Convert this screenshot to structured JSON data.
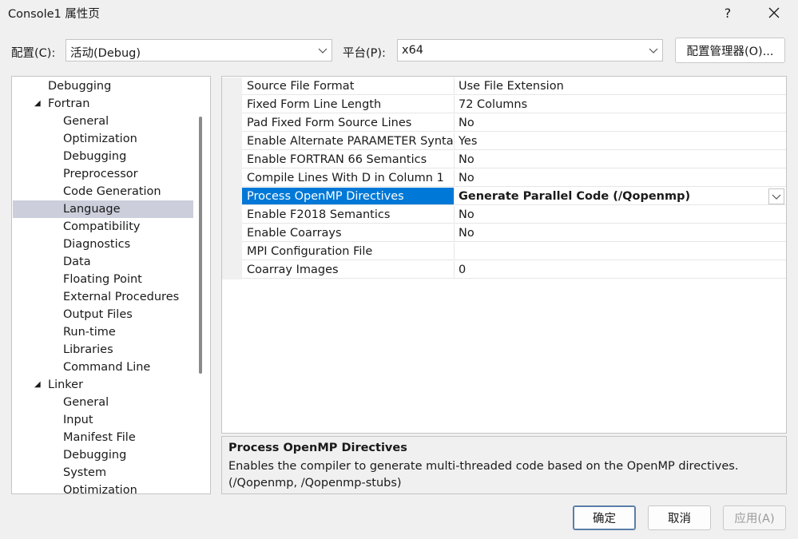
{
  "window": {
    "title": "Console1 属性页",
    "help_label": "?",
    "close_label": "✕"
  },
  "config_bar": {
    "config_label": "配置(C):",
    "config_value": "活动(Debug)",
    "platform_label": "平台(P):",
    "platform_value": "x64",
    "manager_button": "配置管理器(O)..."
  },
  "tree": {
    "items": [
      {
        "label": "Debugging",
        "level": 0,
        "expander": ""
      },
      {
        "label": "Fortran",
        "level": 0,
        "expander": "◢"
      },
      {
        "label": "General",
        "level": 1,
        "expander": ""
      },
      {
        "label": "Optimization",
        "level": 1,
        "expander": ""
      },
      {
        "label": "Debugging",
        "level": 1,
        "expander": ""
      },
      {
        "label": "Preprocessor",
        "level": 1,
        "expander": ""
      },
      {
        "label": "Code Generation",
        "level": 1,
        "expander": ""
      },
      {
        "label": "Language",
        "level": 1,
        "expander": "",
        "selected": true
      },
      {
        "label": "Compatibility",
        "level": 1,
        "expander": ""
      },
      {
        "label": "Diagnostics",
        "level": 1,
        "expander": ""
      },
      {
        "label": "Data",
        "level": 1,
        "expander": ""
      },
      {
        "label": "Floating Point",
        "level": 1,
        "expander": ""
      },
      {
        "label": "External Procedures",
        "level": 1,
        "expander": ""
      },
      {
        "label": "Output Files",
        "level": 1,
        "expander": ""
      },
      {
        "label": "Run-time",
        "level": 1,
        "expander": ""
      },
      {
        "label": "Libraries",
        "level": 1,
        "expander": ""
      },
      {
        "label": "Command Line",
        "level": 1,
        "expander": ""
      },
      {
        "label": "Linker",
        "level": 0,
        "expander": "◢"
      },
      {
        "label": "General",
        "level": 1,
        "expander": ""
      },
      {
        "label": "Input",
        "level": 1,
        "expander": ""
      },
      {
        "label": "Manifest File",
        "level": 1,
        "expander": ""
      },
      {
        "label": "Debugging",
        "level": 1,
        "expander": ""
      },
      {
        "label": "System",
        "level": 1,
        "expander": ""
      },
      {
        "label": "Optimization",
        "level": 1,
        "expander": ""
      }
    ]
  },
  "properties": [
    {
      "name": "Source File Format",
      "value": "Use File Extension"
    },
    {
      "name": "Fixed Form Line Length",
      "value": "72 Columns"
    },
    {
      "name": "Pad Fixed Form Source Lines",
      "value": "No"
    },
    {
      "name": "Enable Alternate PARAMETER Syntax",
      "value": "Yes"
    },
    {
      "name": "Enable FORTRAN 66 Semantics",
      "value": "No"
    },
    {
      "name": "Compile Lines With D in Column 1",
      "value": "No"
    },
    {
      "name": "Process OpenMP Directives",
      "value": "Generate Parallel Code (/Qopenmp)",
      "selected": true
    },
    {
      "name": "Enable F2018 Semantics",
      "value": "No"
    },
    {
      "name": "Enable Coarrays",
      "value": "No"
    },
    {
      "name": "MPI Configuration File",
      "value": ""
    },
    {
      "name": "Coarray Images",
      "value": "0"
    }
  ],
  "description": {
    "title": "Process OpenMP Directives",
    "text": "Enables the compiler to generate multi-threaded code based on the OpenMP directives. (/Qopenmp, /Qopenmp-stubs)"
  },
  "buttons": {
    "ok": "确定",
    "cancel": "取消",
    "apply": "应用(A)"
  },
  "colors": {
    "selection_blue": "#0078d7",
    "tree_selection": "#cccedb"
  }
}
